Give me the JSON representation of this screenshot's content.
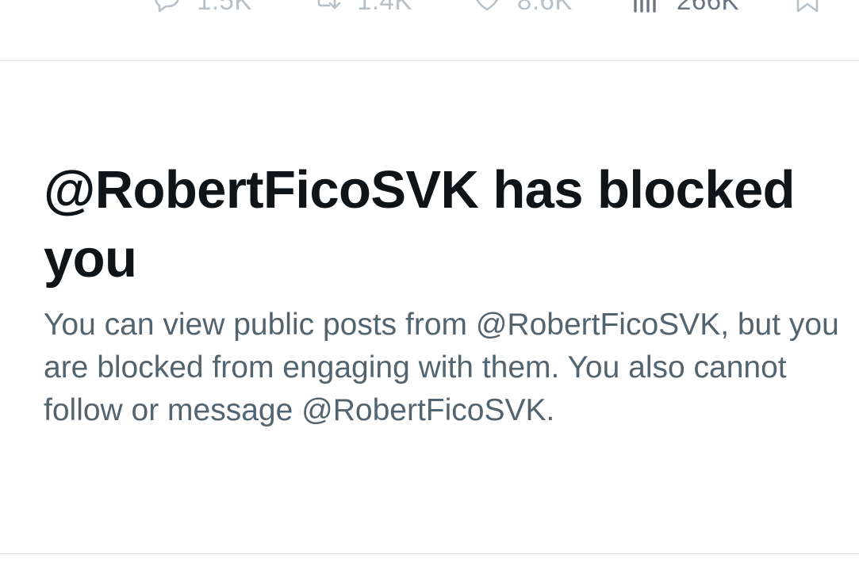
{
  "tweet_actions": {
    "reply": {
      "icon": "reply-icon",
      "count": "1.5K"
    },
    "repost": {
      "icon": "repost-icon",
      "count": "1.4K"
    },
    "like": {
      "icon": "heart-icon",
      "count": "8.6K"
    },
    "views": {
      "icon": "bar-chart-icon",
      "count": "266K"
    },
    "bookmark": {
      "icon": "bookmark-icon"
    }
  },
  "block_notice": {
    "title": "@RobertFicoSVK has blocked you",
    "body": "You can view public posts from @RobertFicoSVK, but you are blocked from engaging with them. You also cannot follow or message @RobertFicoSVK."
  },
  "colors": {
    "title_text": "#0f1419",
    "body_text": "#536471",
    "divider": "#dfe3e6",
    "faded_icon": "#b9c1c8"
  }
}
